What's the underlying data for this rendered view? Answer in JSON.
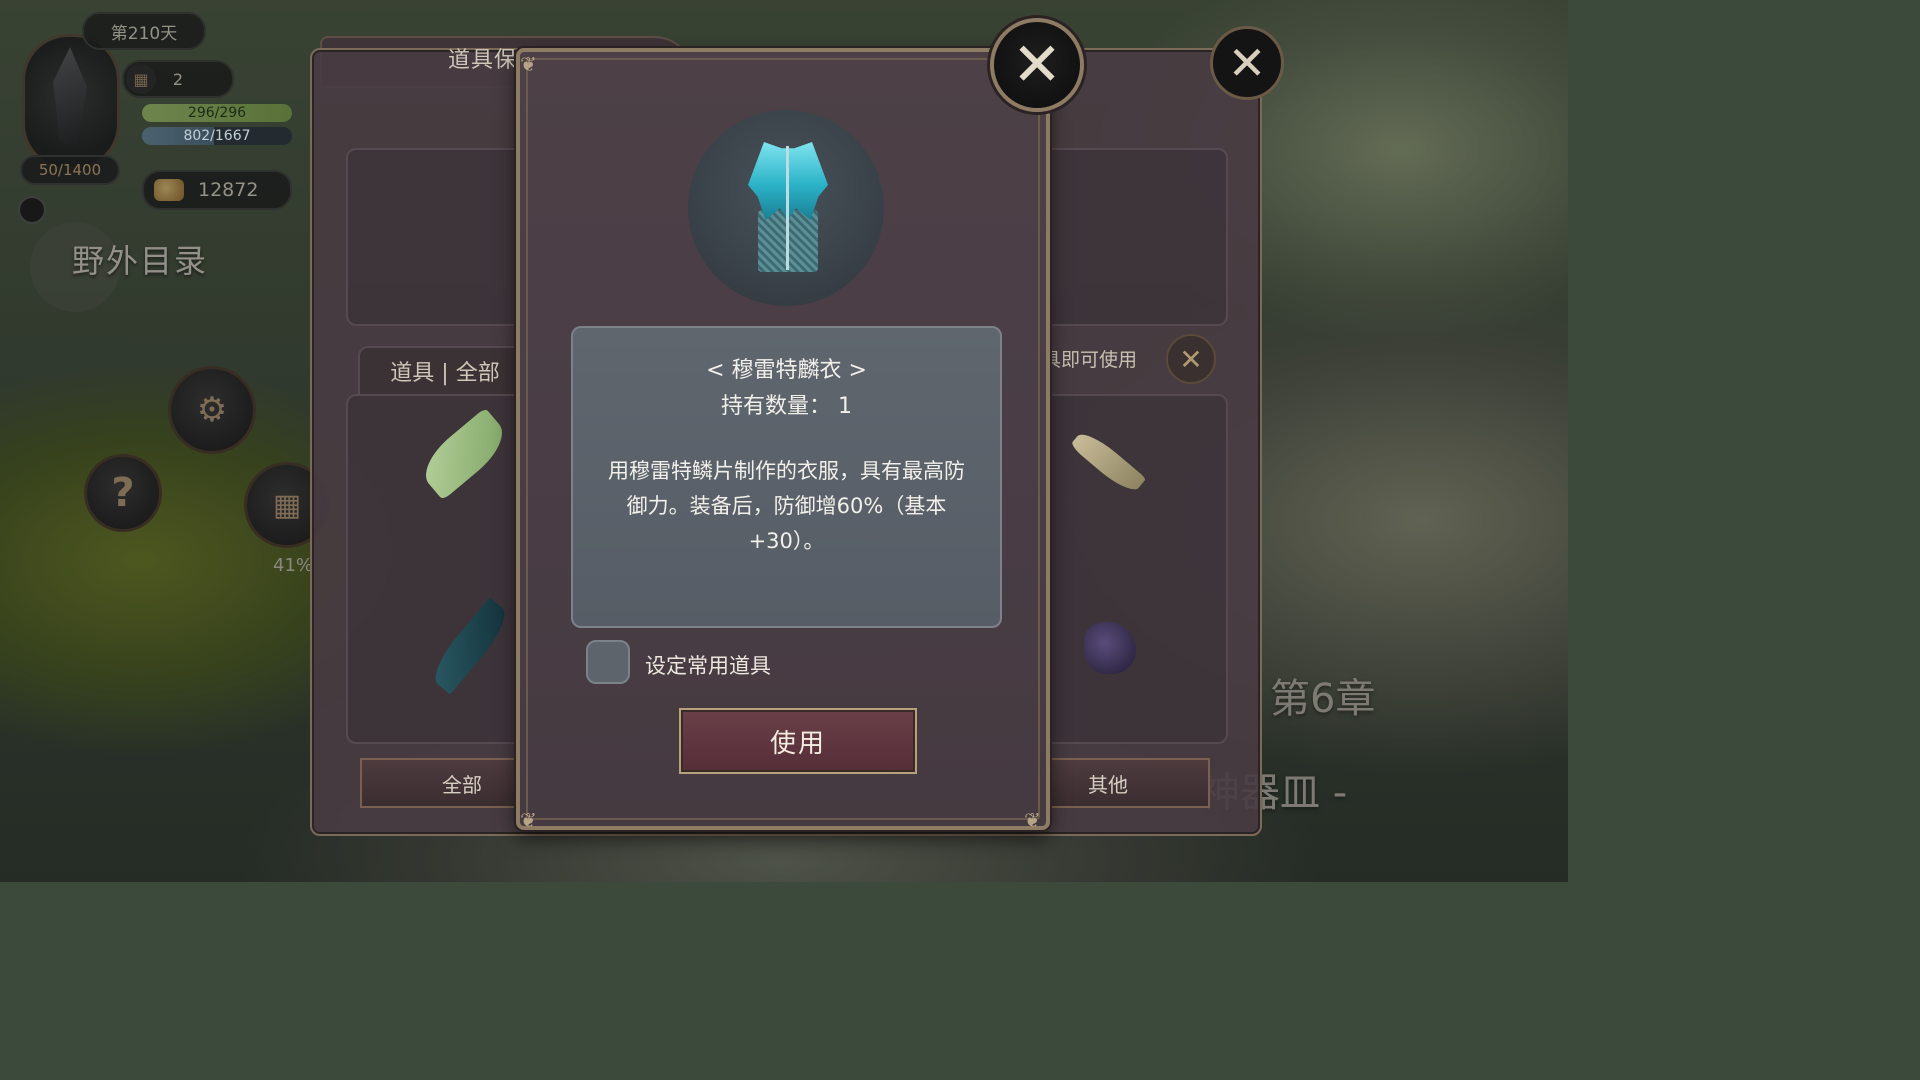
{
  "hud": {
    "day": "第210天",
    "calendar_count": "2",
    "hp": "296/296",
    "hp_fill": 1.0,
    "mp": "802/1667",
    "mp_fill": 0.48,
    "xp": "50/1400",
    "gold": "12872",
    "field_menu": "野外目录",
    "progress_percent": "41%",
    "chapter": "第6章",
    "chapter_subtitle": "神器皿 -"
  },
  "storage": {
    "title": "道具保管箱",
    "filter_tab": "道具 | 全部",
    "quick_use_hint": "点击道具即可使用",
    "categories": [
      "全部",
      "其他"
    ]
  },
  "dialog": {
    "item_name": "< 穆雷特麟衣 >",
    "item_count": "持有数量： 1",
    "description": "用穆雷特鳞片制作的衣服，具有最高防御力。装备后，防御增60%（基本+30）。",
    "favorite_label": "设定常用道具",
    "favorite_checked": false,
    "use_button": "使用"
  },
  "icons": {
    "close": "close-icon",
    "gear": "gear-icon",
    "help": "help-icon",
    "calendar": "calendar-icon",
    "gold": "gold-coins-icon",
    "armor": "scale-armor-icon"
  }
}
